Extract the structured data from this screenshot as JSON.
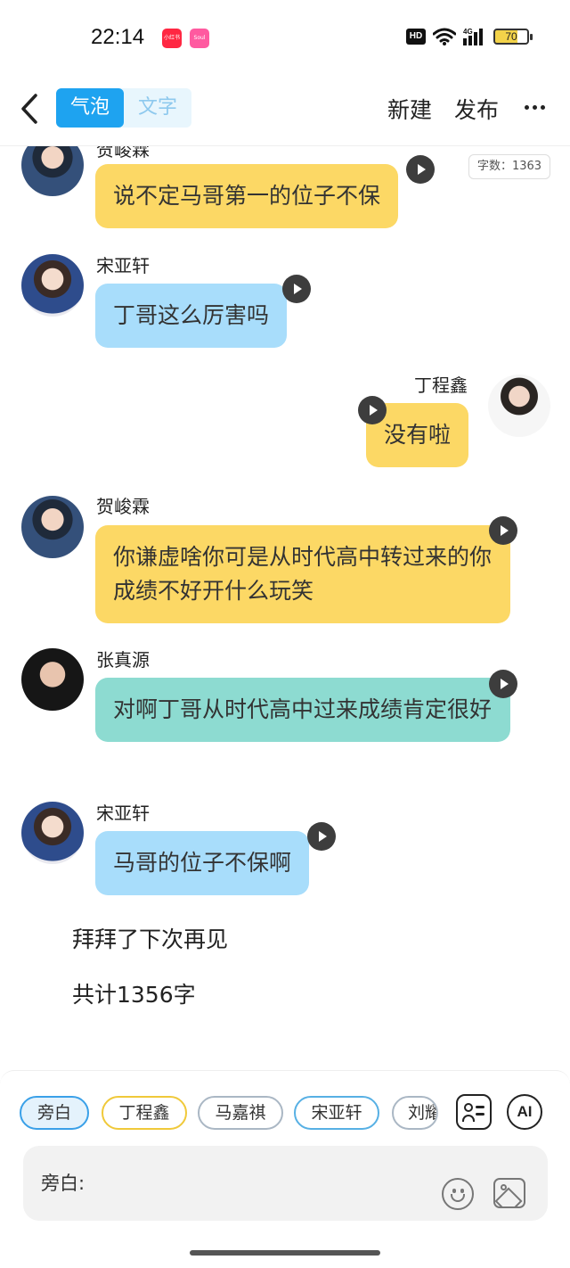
{
  "status_bar": {
    "time": "22:14",
    "badge_red": "小红书",
    "badge_pink": "Soul",
    "hd": "HD",
    "network": "4G",
    "battery": "70"
  },
  "header": {
    "tabs": [
      {
        "label": "气泡",
        "active": true
      },
      {
        "label": "文字",
        "active": false
      }
    ],
    "new_label": "新建",
    "publish_label": "发布"
  },
  "word_count": "字数：1363",
  "messages": [
    {
      "speaker": "贺峻霖",
      "text": "说不定马哥第一的位子不保",
      "side": "left",
      "color": "yellow"
    },
    {
      "speaker": "宋亚轩",
      "text": "丁哥这么厉害吗",
      "side": "left",
      "color": "blue"
    },
    {
      "speaker": "丁程鑫",
      "text": "没有啦",
      "side": "right",
      "color": "yellow"
    },
    {
      "speaker": "贺峻霖",
      "text": "你谦虚啥你可是从时代高中转过来的你成绩不好开什么玩笑",
      "side": "left",
      "color": "yellow"
    },
    {
      "speaker": "张真源",
      "text": "对啊丁哥从时代高中过来成绩肯定很好",
      "side": "left",
      "color": "teal"
    },
    {
      "speaker": "宋亚轩",
      "text": "马哥的位子不保啊",
      "side": "left",
      "color": "blue"
    }
  ],
  "narrations": [
    "拜拜了下次再见",
    "共计1356字"
  ],
  "composer": {
    "chips": [
      "旁白",
      "丁程鑫",
      "马嘉祺",
      "宋亚轩",
      "刘耀"
    ],
    "ai_label": "AI",
    "input_label": "旁白:"
  },
  "colors": {
    "accent": "#1ea3f0",
    "bubble_yellow": "#fcd865",
    "bubble_blue": "#a8ddfb",
    "bubble_teal": "#8ddbd1"
  },
  "icons": [
    "back-arrow-icon",
    "more-icon",
    "play-icon",
    "role-card-icon",
    "emoji-icon",
    "image-icon",
    "wifi-icon",
    "signal-icon",
    "battery-icon"
  ]
}
